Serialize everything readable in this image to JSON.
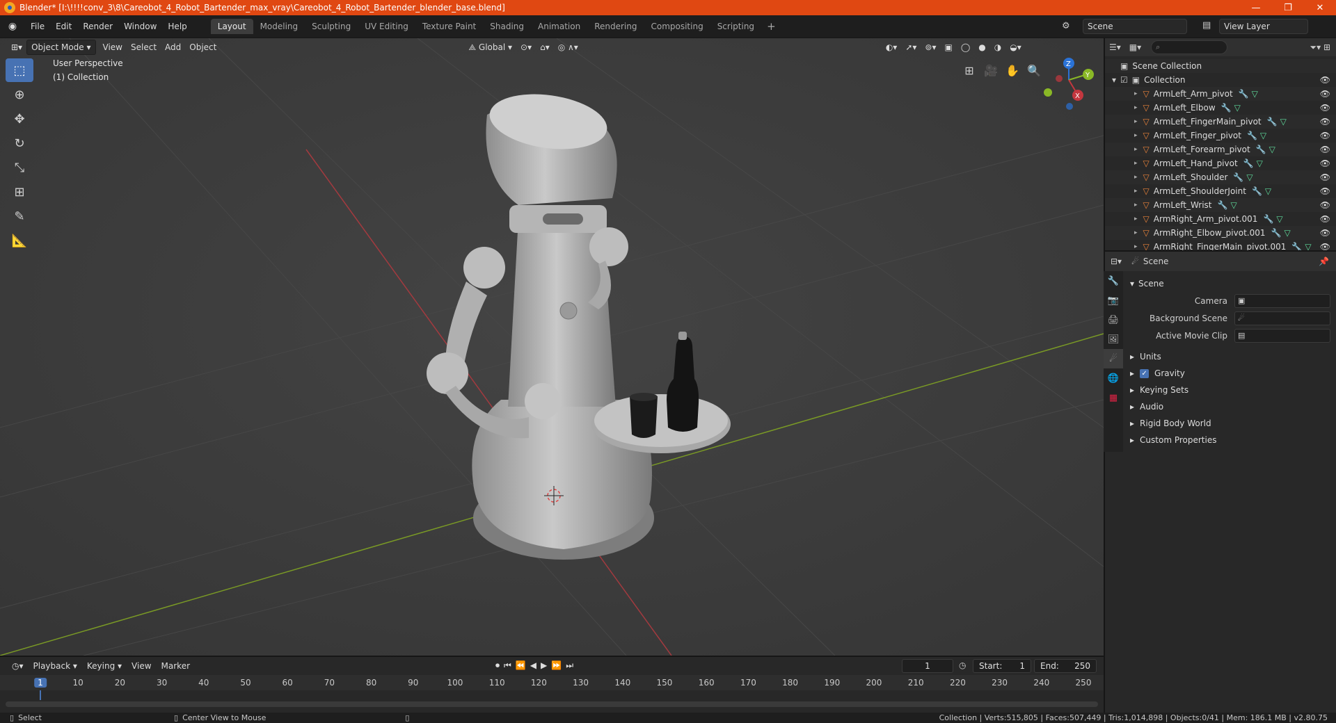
{
  "titlebar": {
    "title": "Blender* [I:\\!!!!conv_3\\8\\Careobot_4_Robot_Bartender_max_vray\\Careobot_4_Robot_Bartender_blender_base.blend]",
    "minimize": "—",
    "restore": "❐",
    "close": "✕"
  },
  "menubar": {
    "items": [
      "File",
      "Edit",
      "Render",
      "Window",
      "Help"
    ],
    "workspaces": [
      "Layout",
      "Modeling",
      "Sculpting",
      "UV Editing",
      "Texture Paint",
      "Shading",
      "Animation",
      "Rendering",
      "Compositing",
      "Scripting"
    ],
    "active_workspace": "Layout",
    "scene": "Scene",
    "view_layer": "View Layer"
  },
  "viewport": {
    "mode": "Object Mode",
    "menus": [
      "View",
      "Select",
      "Add",
      "Object"
    ],
    "transform_orientation": "Global",
    "perspective_label": "User Perspective",
    "collection_label": "(1) Collection",
    "gizmo": {
      "z": "Z",
      "y": "Y",
      "x": "X"
    },
    "colors": {
      "x_axis": "#c4373f",
      "y_axis": "#8ab826",
      "z_axis": "#2a72d6",
      "bg": "#3b3b3b"
    }
  },
  "outliner": {
    "root": "Scene Collection",
    "collection": "Collection",
    "items": [
      "ArmLeft_Arm_pivot",
      "ArmLeft_Elbow",
      "ArmLeft_FingerMain_pivot",
      "ArmLeft_Finger_pivot",
      "ArmLeft_Forearm_pivot",
      "ArmLeft_Hand_pivot",
      "ArmLeft_Shoulder",
      "ArmLeft_ShoulderJoint",
      "ArmLeft_Wrist",
      "ArmRight_Arm_pivot.001",
      "ArmRight_Elbow_pivot.001",
      "ArmRight_FingerMain_pivot.001"
    ]
  },
  "properties": {
    "header": "Scene",
    "section": "Scene",
    "fields": [
      {
        "label": "Camera",
        "value": ""
      },
      {
        "label": "Background Scene",
        "value": ""
      },
      {
        "label": "Active Movie Clip",
        "value": ""
      }
    ],
    "panels": [
      "Units",
      "Gravity",
      "Keying Sets",
      "Audio",
      "Rigid Body World",
      "Custom Properties"
    ],
    "gravity_checked": true
  },
  "timeline": {
    "menus": [
      "Playback",
      "Keying",
      "View",
      "Marker"
    ],
    "current_frame": "1",
    "start_label": "Start:",
    "start": "1",
    "end_label": "End:",
    "end": "250",
    "ticks": [
      "1",
      "10",
      "20",
      "30",
      "40",
      "50",
      "60",
      "70",
      "80",
      "90",
      "100",
      "110",
      "120",
      "130",
      "140",
      "150",
      "160",
      "170",
      "180",
      "190",
      "200",
      "210",
      "220",
      "230",
      "240",
      "250"
    ]
  },
  "statusbar": {
    "left": "Select",
    "middle": "Center View to Mouse",
    "stats": "Collection | Verts:515,805 | Faces:507,449 | Tris:1,014,898 | Objects:0/41 | Mem: 186.1 MB | v2.80.75"
  }
}
